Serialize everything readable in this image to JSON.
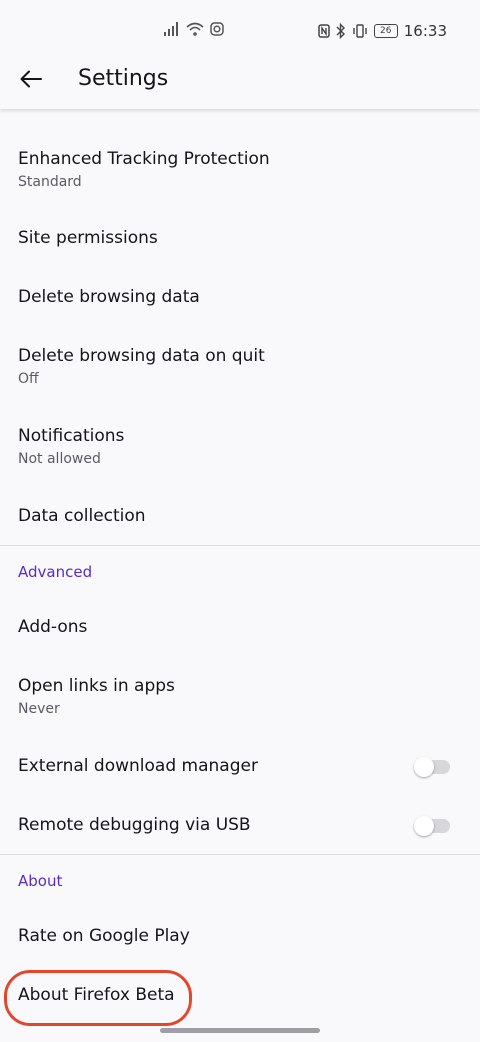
{
  "status_bar": {
    "time": "16:33",
    "battery": "26"
  },
  "appbar": {
    "title": "Settings"
  },
  "items": {
    "etp": {
      "title": "Enhanced Tracking Protection",
      "subtitle": "Standard"
    },
    "site_permissions": {
      "title": "Site permissions"
    },
    "delete_data": {
      "title": "Delete browsing data"
    },
    "delete_on_quit": {
      "title": "Delete browsing data on quit",
      "subtitle": "Off"
    },
    "notifications": {
      "title": "Notifications",
      "subtitle": "Not allowed"
    },
    "data_collection": {
      "title": "Data collection"
    },
    "addons": {
      "title": "Add-ons"
    },
    "open_links": {
      "title": "Open links in apps",
      "subtitle": "Never"
    },
    "external_dl": {
      "title": "External download manager",
      "enabled": false
    },
    "remote_debug": {
      "title": "Remote debugging via USB",
      "enabled": false
    },
    "rate": {
      "title": "Rate on Google Play"
    },
    "about": {
      "title": "About Firefox Beta"
    }
  },
  "sections": {
    "advanced": "Advanced",
    "about": "About"
  },
  "colors": {
    "accent": "#592acb",
    "highlight": "#e4462c"
  }
}
